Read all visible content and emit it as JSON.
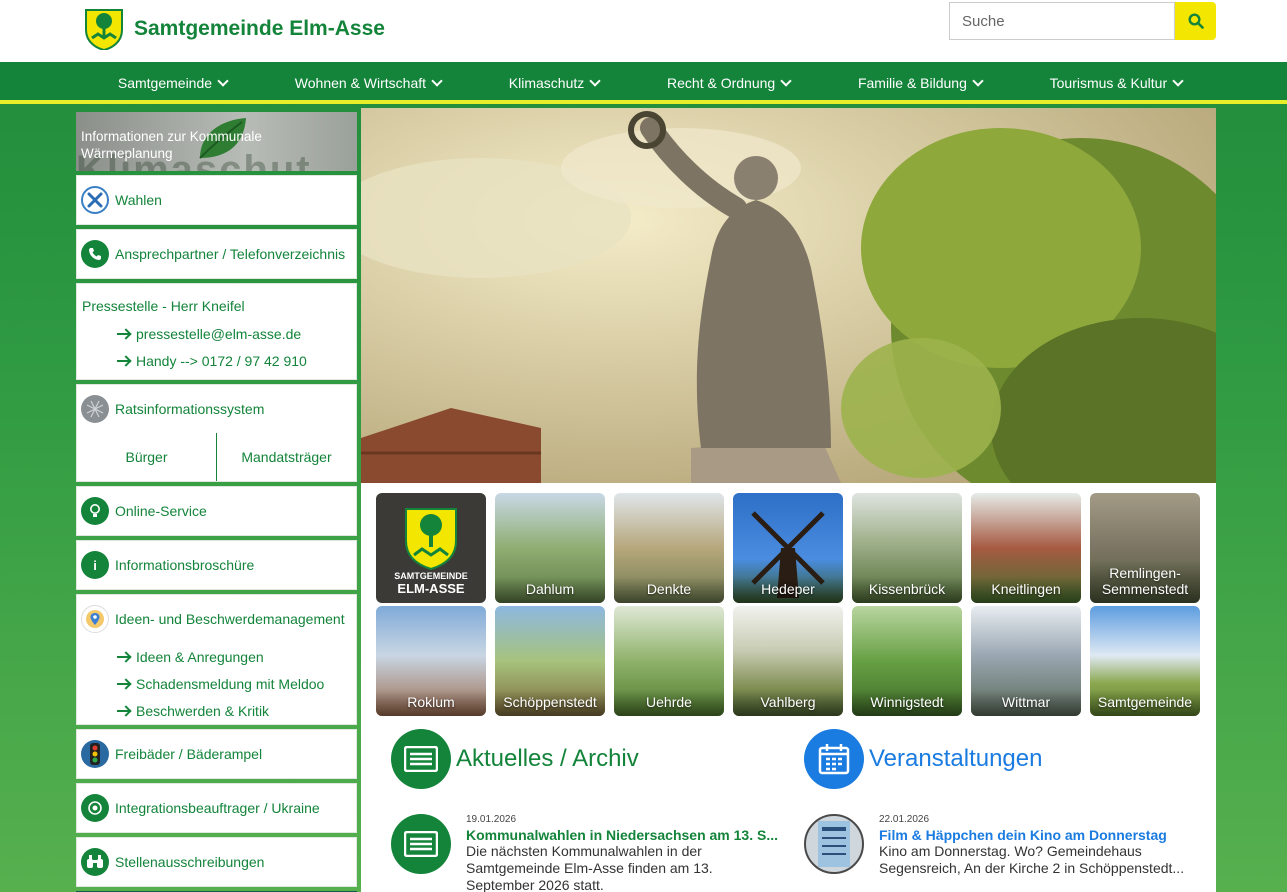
{
  "site": {
    "title": "Samtgemeinde Elm-Asse"
  },
  "search": {
    "placeholder": "Suche"
  },
  "nav": [
    {
      "label": "Samtgemeinde"
    },
    {
      "label": "Wohnen & Wirtschaft"
    },
    {
      "label": "Klimaschutz"
    },
    {
      "label": "Recht & Ordnung"
    },
    {
      "label": "Familie & Bildung"
    },
    {
      "label": "Tourismus & Kultur"
    }
  ],
  "sidebar": {
    "banner": "Informationen zur Kommunale Wärmeplanung",
    "wahlen": "Wahlen",
    "contacts": "Ansprechpartner / Telefonverzeichnis",
    "press": {
      "title": "Pressestelle - Herr Kneifel",
      "links": [
        "pressestelle@elm-asse.de",
        "Handy --> 0172 / 97 42 910"
      ]
    },
    "ratsinfo": {
      "label": "Ratsinformationssystem",
      "buttons": [
        "Bürger",
        "Mandatsträger"
      ]
    },
    "online": "Online-Service",
    "brochure": "Informationsbroschüre",
    "ideas": {
      "label": "Ideen- und Beschwerdemanagement",
      "links": [
        "Ideen & Anregungen",
        "Schadensmeldung mit Meldoo",
        "Beschwerden & Kritik"
      ]
    },
    "pools": "Freibäder / Bäderampel",
    "integration": "Integrationsbeauftrager / Ukraine",
    "jobs": "Stellenausschreibungen"
  },
  "tiles": [
    {
      "label": "",
      "color": "#3c3a36"
    },
    {
      "label": "Dahlum",
      "color": "#7f9c6a"
    },
    {
      "label": "Denkte",
      "color": "#8d9470"
    },
    {
      "label": "Hedeper",
      "color": "#3d7fd0"
    },
    {
      "label": "Kissenbrück",
      "color": "#6f8a5a"
    },
    {
      "label": "Kneitlingen",
      "color": "#577e3d"
    },
    {
      "label": "Remlingen-\nSemmenstedt",
      "color": "#7a7462"
    },
    {
      "label": "Roklum",
      "color": "#7fa4cf"
    },
    {
      "label": "Schöppenstedt",
      "color": "#a7c37d"
    },
    {
      "label": "Uehrde",
      "color": "#8fb26a"
    },
    {
      "label": "Vahlberg",
      "color": "#b7b9a4"
    },
    {
      "label": "Winnigstedt",
      "color": "#67a044"
    },
    {
      "label": "Wittmar",
      "color": "#74879a"
    },
    {
      "label": "Samtgemeinde",
      "color": "#6a9fd7"
    }
  ],
  "crest_text": "SAMTGEMEINDE\nELM-ASSE",
  "sections": {
    "news": {
      "title": "Aktuelles / Archiv",
      "color": "#13843a"
    },
    "events": {
      "title": "Veranstaltungen",
      "color": "#1a7be0"
    }
  },
  "news_items": [
    {
      "date": "19.01.2026",
      "title": "Kommunalwahlen in Niedersachsen am 13. S...",
      "text": "Die nächsten Kommunalwahlen in der Samtgemeinde Elm-Asse finden am 13. September 2026 statt."
    }
  ],
  "event_items": [
    {
      "date": "22.01.2026",
      "title": "Film & Häppchen dein Kino am Donnerstag",
      "text": "Kino am Donnerstag. Wo? Gemeindehaus Segensreich, An der Kirche 2 in Schöppenstedt..."
    }
  ]
}
